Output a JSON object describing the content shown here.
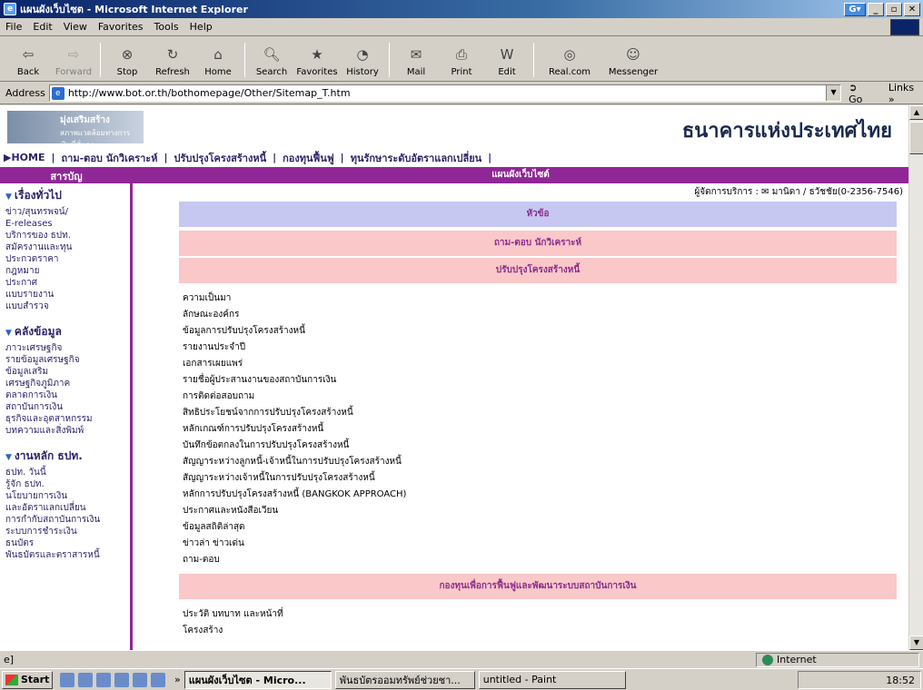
{
  "window": {
    "title": "แผนผังเว็บไซต - Microsoft Internet Explorer"
  },
  "menu": [
    "File",
    "Edit",
    "View",
    "Favorites",
    "Tools",
    "Help"
  ],
  "toolbar": [
    {
      "label": "Back",
      "icon": "back-arrow-icon",
      "enabled": true
    },
    {
      "label": "Forward",
      "icon": "forward-arrow-icon",
      "enabled": false
    },
    {
      "label": "Stop",
      "icon": "stop-icon",
      "enabled": true
    },
    {
      "label": "Refresh",
      "icon": "refresh-icon",
      "enabled": true
    },
    {
      "label": "Home",
      "icon": "home-icon",
      "enabled": true
    },
    {
      "label": "Search",
      "icon": "search-icon",
      "enabled": true
    },
    {
      "label": "Favorites",
      "icon": "favorites-icon",
      "enabled": true
    },
    {
      "label": "History",
      "icon": "history-icon",
      "enabled": true
    },
    {
      "label": "Mail",
      "icon": "mail-icon",
      "enabled": true
    },
    {
      "label": "Print",
      "icon": "print-icon",
      "enabled": true
    },
    {
      "label": "Edit",
      "icon": "edit-icon",
      "enabled": true
    },
    {
      "label": "Real.com",
      "icon": "realcom-icon",
      "enabled": true
    },
    {
      "label": "Messenger",
      "icon": "messenger-icon",
      "enabled": true
    }
  ],
  "address": {
    "label": "Address",
    "url": "http://www.bot.or.th/bothomepage/Other/Sitemap_T.htm",
    "go_label": "Go",
    "links_label": "Links"
  },
  "page": {
    "banner_left_title": "มุ่งเสริมสร้าง",
    "banner_left_sub": "สภาพแวดล้อมทางการเงินที่มั่นคง",
    "banner_right": "ธนาคารแห่งประเทศไทย",
    "nav": [
      "▶HOME",
      "ถาม-ตอบ นักวิเคราะห์",
      "ปรับปรุงโครงสร้างหนี้",
      "กองทุนฟื้นฟู",
      "ทุนรักษาระดับอัตราแลกเปลี่ยน"
    ],
    "sidebar_title": "สารบัญ",
    "content_title": "แผนผังเว็บไซต์",
    "contact": "ผู้จัดการบริการ : ✉ มานิดา / ธวัชชัย(0-2356-7546)",
    "rows": [
      {
        "text": "หัวข้อ",
        "style": "blue"
      },
      {
        "text": "ถาม-ตอบ นักวิเคราะห์",
        "style": "pink"
      },
      {
        "text": "ปรับปรุงโครงสร้างหนี้",
        "style": "pink"
      }
    ],
    "links": [
      "ความเป็นมา",
      "ลักษณะองค์กร",
      "ข้อมูลการปรับปรุงโครงสร้างหนี้",
      "รายงานประจำปี",
      "เอกสารเผยแพร่",
      "รายชื่อผู้ประสานงานของสถาบันการเงิน",
      "การติดต่อสอบถาม",
      "สิทธิประโยชน์จากการปรับปรุงโครงสร้างหนี้",
      "หลักเกณฑ์การปรับปรุงโครงสร้างหนี้",
      "บันทึกข้อตกลงในการปรับปรุงโครงสร้างหนี้",
      "สัญญาระหว่างลูกหนี้-เจ้าหนี้ในการปรับปรุงโครงสร้างหนี้",
      "สัญญาระหว่างเจ้าหนี้ในการปรับปรุงโครงสร้างหนี้",
      "หลักการปรับปรุงโครงสร้างหนี้ (BANGKOK APPROACH)",
      "ประกาศและหนังสือเวียน",
      "ข้อมูลสถิติล่าสุด",
      "ข่าวล่า ข่าวเด่น",
      "ถาม-ตอบ"
    ],
    "row4": "กองทุนเพื่อการฟื้นฟูและพัฒนาระบบสถาบันการเงิน",
    "links2": [
      "ประวัติ บทบาท และหน้าที่",
      "โครงสร้าง"
    ],
    "side_groups": [
      {
        "head": "เรื่องทั่วไป",
        "items": [
          "ข่าว/สุนทรพจน์/",
          "E-releases",
          "บริการของ ธปท.",
          "สมัครงานและทุน",
          "ประกวดราคา",
          "กฎหมาย",
          "ประกาศ",
          "แบบรายงาน",
          "แบบสำรวจ"
        ]
      },
      {
        "head": "คลังข้อมูล",
        "items": [
          "ภาวะเศรษฐกิจ",
          "รายข้อมูลเศรษฐกิจ",
          "ข้อมูลเสริม",
          "เศรษฐกิจภูมิภาค",
          "ตลาดการเงิน",
          "สถาบันการเงิน",
          "ธุรกิจและอุตสาหกรรม",
          "บทความและสิ่งพิมพ์"
        ]
      },
      {
        "head": "งานหลัก ธปท.",
        "items": [
          "ธปท. วันนี้",
          "รู้จัก ธปท.",
          "นโยบายการเงิน",
          "และอัตราแลกเปลี่ยน",
          "การกำกับสถาบันการเงิน",
          "ระบบการชำระเงิน",
          "ธนบัตร",
          "พันธบัตรและตราสารหนี้"
        ]
      }
    ]
  },
  "status": {
    "zone": "Internet"
  },
  "taskbar": {
    "start": "Start",
    "tasks": [
      {
        "label": "แผนผังเว็บไซต - Micro...",
        "active": true
      },
      {
        "label": "พันธบัตรออมทรัพย์ช่วยชา...",
        "active": false
      },
      {
        "label": "untitled - Paint",
        "active": false
      }
    ],
    "clock": "18:52"
  }
}
